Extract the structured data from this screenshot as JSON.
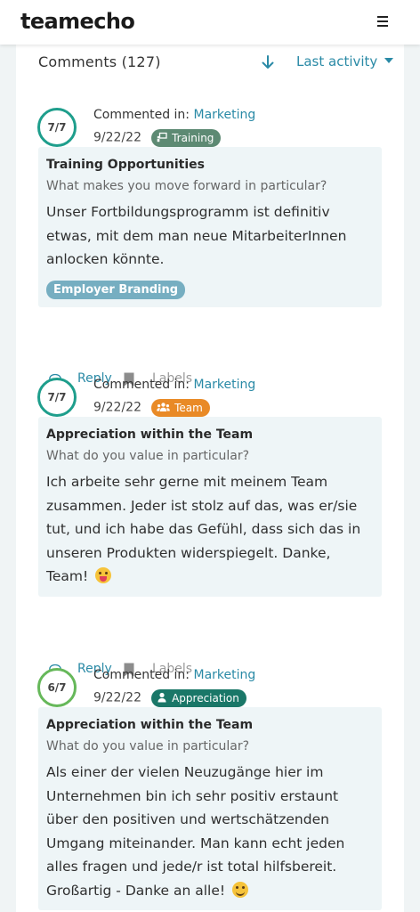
{
  "header": {
    "logo": "teamecho",
    "menu_icon": "hamburger-menu-icon"
  },
  "list": {
    "title": "Comments (127)",
    "sort_label": "Last activity",
    "sort_icon": "arrow-down-icon"
  },
  "actions": {
    "reply": "Reply",
    "labels": "Labels"
  },
  "colors": {
    "accent": "#2a8aa6",
    "ring_teal": "#1e9e8c",
    "ring_green": "#66b85a",
    "card_bg": "#eef5f7"
  },
  "comments": [
    {
      "score": "7/7",
      "commented_in_label": "Commented in:",
      "channel": "Marketing",
      "date": "9/22/22",
      "tag": "Training",
      "tag_icon": "training-board-icon",
      "topic": "Training Opportunities",
      "question": "What makes you move forward in particular?",
      "text": "Unser Fortbildungsprogramm ist definitiv etwas, mit dem man neue MitarbeiterInnen anlocken könnte.",
      "label": "Employer Branding"
    },
    {
      "score": "7/7",
      "commented_in_label": "Commented in:",
      "channel": "Marketing",
      "date": "9/22/22",
      "tag": "Team",
      "tag_icon": "users-icon",
      "topic": "Appreciation within the Team",
      "question": "What do you value in particular?",
      "text": "Ich arbeite sehr gerne mit meinem Team zusammen. Jeder ist stolz auf das, was er/sie tut, und ich habe das Gefühl, dass sich das in unseren Produkten widerspiegelt. Danke, Team!",
      "emoji": "tongue-out-emoji"
    },
    {
      "score": "6/7",
      "commented_in_label": "Commented in:",
      "channel": "Marketing",
      "date": "9/22/22",
      "tag": "Appreciation",
      "tag_icon": "medal-icon",
      "topic": "Appreciation within the Team",
      "question": "What do you value in particular?",
      "text": "Als einer der vielen Neuzugänge hier im Unternehmen bin ich sehr positiv erstaunt über den positiven und wertschätzenden Umgang miteinander. Man kann echt jeden alles fragen und jede/r ist total hilfsbereit. Großartig - Danke an alle!",
      "emoji": "smile-emoji"
    }
  ]
}
